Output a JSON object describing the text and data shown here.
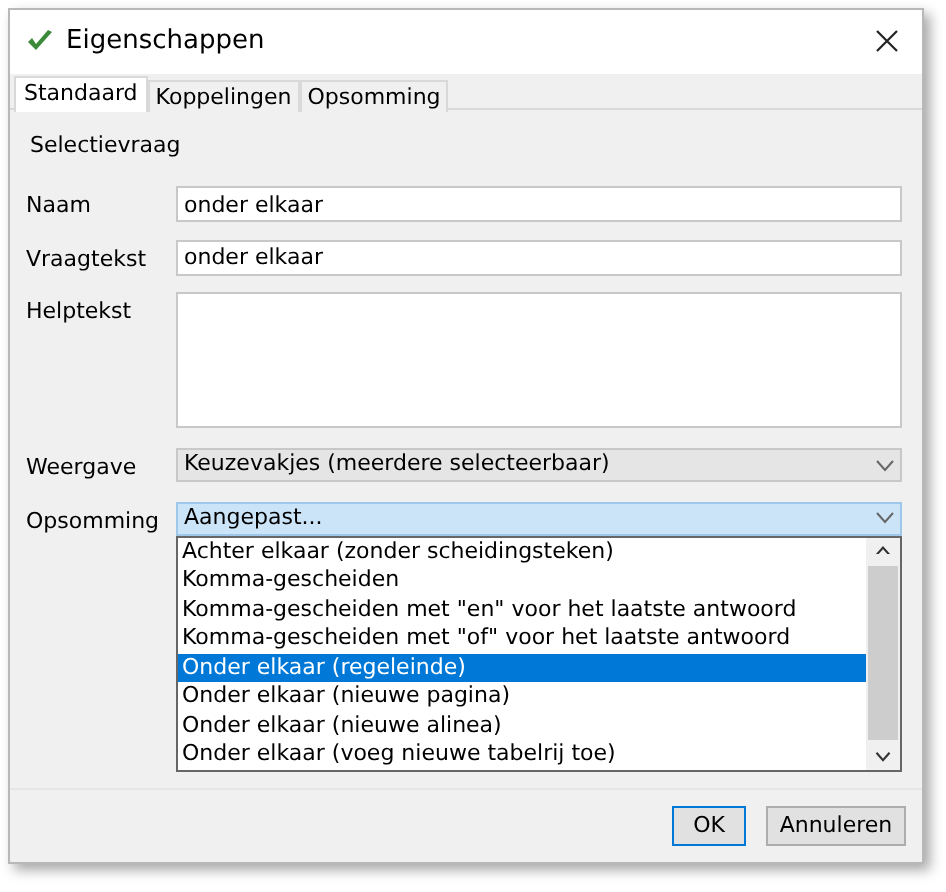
{
  "window": {
    "title": "Eigenschappen"
  },
  "tabs": [
    {
      "label": "Standaard",
      "selected": true
    },
    {
      "label": "Koppelingen",
      "selected": false
    },
    {
      "label": "Opsomming",
      "selected": false
    }
  ],
  "section_title": "Selectievraag",
  "fields": [
    {
      "kind": "text",
      "label": "Naam",
      "value": "onder elkaar"
    },
    {
      "kind": "text",
      "label": "Vraagtekst",
      "value": "onder elkaar"
    },
    {
      "kind": "textarea",
      "label": "Helptekst"
    },
    {
      "kind": "select",
      "label": "Weergave",
      "value": "Keuzevakjes (meerdere selecteerbaar)",
      "open": false
    },
    {
      "kind": "select",
      "label": "Opsomming",
      "value": "Aangepast...",
      "open": true,
      "options": [
        {
          "label": "Achter elkaar (zonder scheidingsteken)",
          "selected": false
        },
        {
          "label": "Komma-gescheiden",
          "selected": false
        },
        {
          "label": "Komma-gescheiden met \"en\" voor het laatste antwoord",
          "selected": false
        },
        {
          "label": "Komma-gescheiden met \"of\" voor het laatste antwoord",
          "selected": false
        },
        {
          "label": "Onder elkaar (regeleinde)",
          "selected": true
        },
        {
          "label": "Onder elkaar (nieuwe pagina)",
          "selected": false
        },
        {
          "label": "Onder elkaar (nieuwe alinea)",
          "selected": false
        },
        {
          "label": "Onder elkaar (voeg nieuwe tabelrij toe)",
          "selected": false
        }
      ]
    }
  ],
  "buttons": [
    {
      "label": "OK",
      "default": true
    },
    {
      "label": "Annuleren",
      "default": false
    }
  ]
}
